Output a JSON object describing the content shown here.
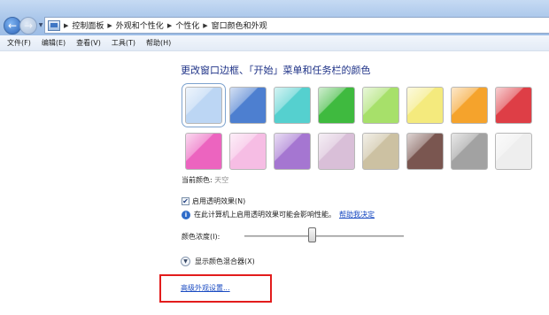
{
  "address_bar": {
    "breadcrumb": [
      "控制面板",
      "外观和个性化",
      "个性化",
      "窗口颜色和外观"
    ]
  },
  "menu": [
    "文件(F)",
    "编辑(E)",
    "查看(V)",
    "工具(T)",
    "帮助(H)"
  ],
  "heading": "更改窗口边框、「开始」菜单和任务栏的颜色",
  "swatches": [
    {
      "name": "sky",
      "color": "#bcd6f4",
      "selected": true
    },
    {
      "name": "twilight",
      "color": "#4d7fd0"
    },
    {
      "name": "sea",
      "color": "#55d0cf"
    },
    {
      "name": "leaf",
      "color": "#3fba3f"
    },
    {
      "name": "lime",
      "color": "#a7e06a"
    },
    {
      "name": "lemon",
      "color": "#f4ea7d"
    },
    {
      "name": "pumpkin",
      "color": "#f5a32c"
    },
    {
      "name": "ruby",
      "color": "#de3e46"
    },
    {
      "name": "fuchsia",
      "color": "#ec64bf"
    },
    {
      "name": "blush",
      "color": "#f6bde4"
    },
    {
      "name": "violet",
      "color": "#a576d1"
    },
    {
      "name": "lavender",
      "color": "#d9bfd8"
    },
    {
      "name": "taupe",
      "color": "#ccc1a2"
    },
    {
      "name": "chocolate",
      "color": "#7a5650"
    },
    {
      "name": "slate",
      "color": "#a2a2a2"
    },
    {
      "name": "frost",
      "color": "#eeeeee"
    }
  ],
  "current_color": {
    "label": "当前颜色:",
    "value": "天空"
  },
  "transparency": {
    "label": "启用透明效果(N)",
    "checked": true
  },
  "info": {
    "text": "在此计算机上启用透明效果可能会影响性能。",
    "link": "帮助我决定"
  },
  "intensity": {
    "label": "颜色浓度(I):",
    "value_fraction": 0.42
  },
  "mixer": {
    "label": "显示颜色混合器(X)"
  },
  "advanced": {
    "label": "高级外观设置..."
  },
  "colors": {
    "link": "#1a4bc2",
    "heading": "#1e3287",
    "highlight_box": "#e21c1c"
  }
}
